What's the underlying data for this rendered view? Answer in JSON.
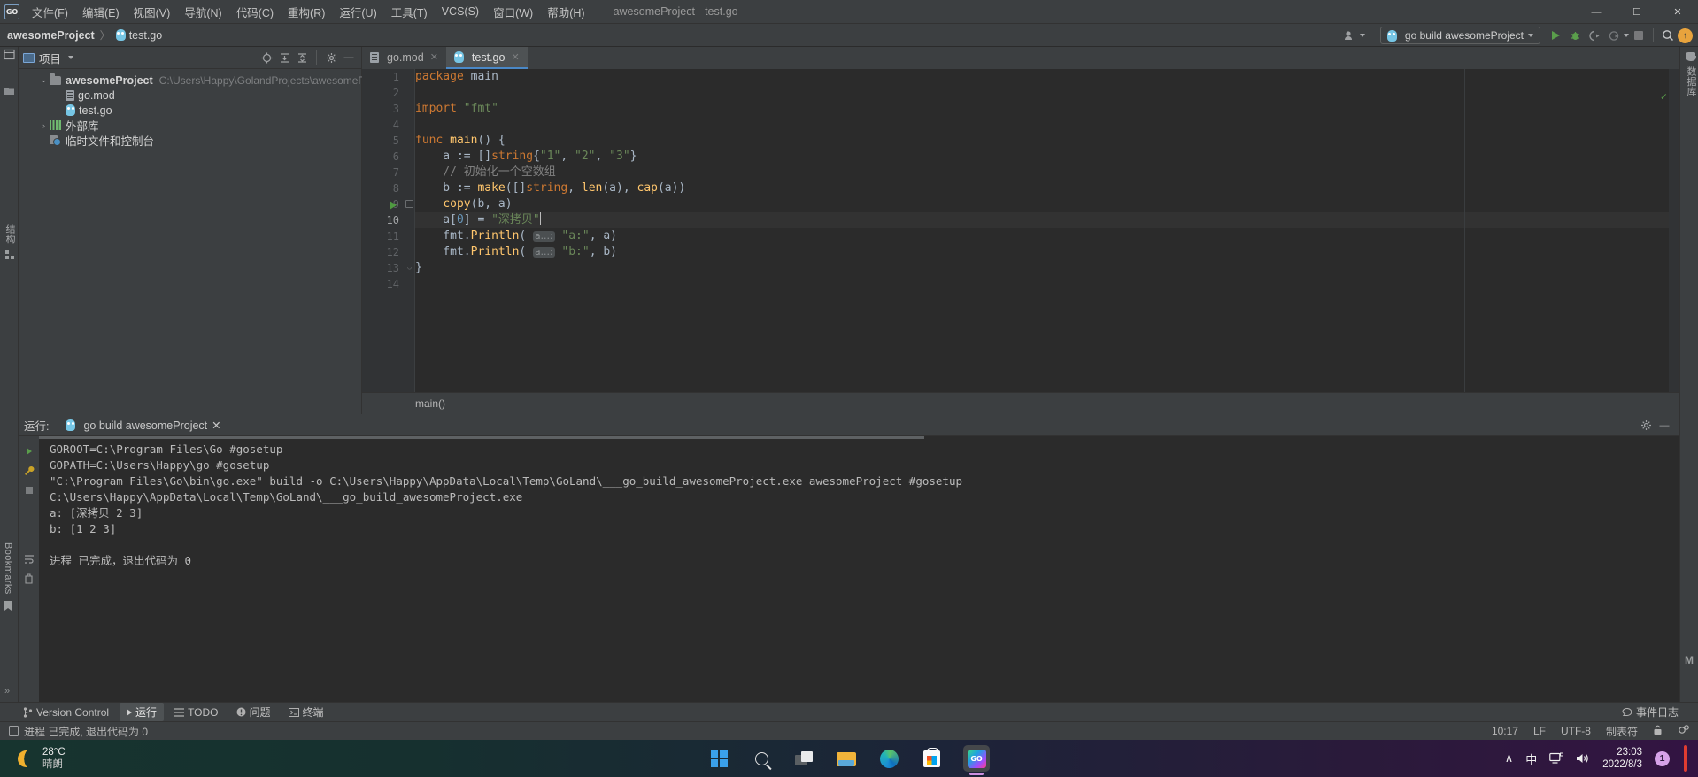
{
  "window": {
    "title": "awesomeProject - test.go",
    "controls": {
      "minimize": "—",
      "maximize": "☐",
      "close": "✕"
    }
  },
  "menu": {
    "items": [
      {
        "label": "文件(F)"
      },
      {
        "label": "编辑(E)"
      },
      {
        "label": "视图(V)"
      },
      {
        "label": "导航(N)"
      },
      {
        "label": "代码(C)"
      },
      {
        "label": "重构(R)"
      },
      {
        "label": "运行(U)"
      },
      {
        "label": "工具(T)"
      },
      {
        "label": "VCS(S)"
      },
      {
        "label": "窗口(W)"
      },
      {
        "label": "帮助(H)"
      }
    ]
  },
  "breadcrumb": {
    "project": "awesomeProject",
    "separator": "〉",
    "file": "test.go"
  },
  "toolbar": {
    "run_config": "go build awesomeProject",
    "icons": [
      "user-avatar-icon",
      "run-icon",
      "debug-icon",
      "run-coverage-icon",
      "profile-icon",
      "stop-icon",
      "search-everywhere-icon",
      "update-icon"
    ],
    "update_glyph": "↑",
    "search_glyph": "⌕",
    "stop_glyph": "■"
  },
  "left_stripe": {
    "items": [
      "结构",
      "Bookmarks"
    ]
  },
  "right_stripe": {
    "items": [
      "数据库"
    ],
    "bottom_label": "M"
  },
  "project_panel": {
    "title": "项目",
    "header_icons": [
      "locate-icon",
      "expand-all-icon",
      "collapse-all-icon",
      "settings-icon",
      "hide-icon"
    ],
    "tree": [
      {
        "depth": 0,
        "arrow": "⌄",
        "icon": "folder-icon",
        "name": "awesomeProject",
        "bold": true,
        "path": "C:\\Users\\Happy\\GolandProjects\\awesomeProject"
      },
      {
        "depth": 1,
        "arrow": "",
        "icon": "gomod-icon",
        "name": "go.mod",
        "bold": false,
        "path": ""
      },
      {
        "depth": 1,
        "arrow": "",
        "icon": "gofile-icon",
        "name": "test.go",
        "bold": false,
        "path": ""
      },
      {
        "depth": 0,
        "arrow": "›",
        "icon": "library-icon",
        "name": "外部库",
        "bold": false,
        "path": ""
      },
      {
        "depth": 0,
        "arrow": "",
        "icon": "scratch-icon",
        "name": "临时文件和控制台",
        "bold": false,
        "path": ""
      }
    ]
  },
  "editor": {
    "tabs": [
      {
        "label": "go.mod",
        "icon": "gomod-icon",
        "active": false,
        "close": "✕"
      },
      {
        "label": "test.go",
        "icon": "gofile-icon",
        "active": true,
        "close": "✕"
      }
    ],
    "gutter_lines": [
      "1",
      "2",
      "3",
      "4",
      "5",
      "6",
      "7",
      "8",
      "9",
      "10",
      "11",
      "12",
      "13",
      "14"
    ],
    "current_line": 10,
    "run_marker_line": 5,
    "lines": [
      {
        "n": 1,
        "tokens": [
          {
            "t": "kw",
            "v": "package"
          },
          {
            "t": "txt",
            "v": " main"
          }
        ]
      },
      {
        "n": 2,
        "tokens": []
      },
      {
        "n": 3,
        "tokens": [
          {
            "t": "kw",
            "v": "import"
          },
          {
            "t": "txt",
            "v": " "
          },
          {
            "t": "str",
            "v": "\"fmt\""
          }
        ]
      },
      {
        "n": 4,
        "tokens": []
      },
      {
        "n": 5,
        "tokens": [
          {
            "t": "kw",
            "v": "func"
          },
          {
            "t": "txt",
            "v": " "
          },
          {
            "t": "fn",
            "v": "main"
          },
          {
            "t": "txt",
            "v": "() {"
          }
        ]
      },
      {
        "n": 6,
        "tokens": [
          {
            "t": "txt",
            "v": "    a := []"
          },
          {
            "t": "kw",
            "v": "string"
          },
          {
            "t": "txt",
            "v": "{"
          },
          {
            "t": "str",
            "v": "\"1\""
          },
          {
            "t": "txt",
            "v": ", "
          },
          {
            "t": "str",
            "v": "\"2\""
          },
          {
            "t": "txt",
            "v": ", "
          },
          {
            "t": "str",
            "v": "\"3\""
          },
          {
            "t": "txt",
            "v": "}"
          }
        ]
      },
      {
        "n": 7,
        "tokens": [
          {
            "t": "cmt",
            "v": "    // 初始化一个空数组"
          }
        ]
      },
      {
        "n": 8,
        "tokens": [
          {
            "t": "txt",
            "v": "    b := "
          },
          {
            "t": "fn",
            "v": "make"
          },
          {
            "t": "txt",
            "v": "([]"
          },
          {
            "t": "kw",
            "v": "string"
          },
          {
            "t": "txt",
            "v": ", "
          },
          {
            "t": "fn",
            "v": "len"
          },
          {
            "t": "txt",
            "v": "(a), "
          },
          {
            "t": "fn",
            "v": "cap"
          },
          {
            "t": "txt",
            "v": "(a))"
          }
        ]
      },
      {
        "n": 9,
        "tokens": [
          {
            "t": "txt",
            "v": "    "
          },
          {
            "t": "fn",
            "v": "copy"
          },
          {
            "t": "txt",
            "v": "(b, a)"
          }
        ]
      },
      {
        "n": 10,
        "tokens": [
          {
            "t": "txt",
            "v": "    a["
          },
          {
            "t": "num",
            "v": "0"
          },
          {
            "t": "txt",
            "v": "] = "
          },
          {
            "t": "str",
            "v": "\"深拷贝\""
          },
          {
            "t": "caret",
            "v": ""
          }
        ]
      },
      {
        "n": 11,
        "tokens": [
          {
            "t": "txt",
            "v": "    fmt."
          },
          {
            "t": "fn",
            "v": "Println"
          },
          {
            "t": "txt",
            "v": "( "
          },
          {
            "t": "hint",
            "v": "a…:"
          },
          {
            "t": "txt",
            "v": " "
          },
          {
            "t": "str",
            "v": "\"a:\""
          },
          {
            "t": "txt",
            "v": ", a)"
          }
        ]
      },
      {
        "n": 12,
        "tokens": [
          {
            "t": "txt",
            "v": "    fmt."
          },
          {
            "t": "fn",
            "v": "Println"
          },
          {
            "t": "txt",
            "v": "( "
          },
          {
            "t": "hint",
            "v": "a…:"
          },
          {
            "t": "txt",
            "v": " "
          },
          {
            "t": "str",
            "v": "\"b:\""
          },
          {
            "t": "txt",
            "v": ", b)"
          }
        ]
      },
      {
        "n": 13,
        "tokens": [
          {
            "t": "txt",
            "v": "}"
          }
        ]
      },
      {
        "n": 14,
        "tokens": []
      }
    ],
    "inspection_status": "✓",
    "breadcrumb": "main()"
  },
  "run_window": {
    "label": "运行:",
    "tab": "go build awesomeProject",
    "tab_close": "✕",
    "console_lines": [
      "GOROOT=C:\\Program Files\\Go #gosetup",
      "GOPATH=C:\\Users\\Happy\\go #gosetup",
      "\"C:\\Program Files\\Go\\bin\\go.exe\" build -o C:\\Users\\Happy\\AppData\\Local\\Temp\\GoLand\\___go_build_awesomeProject.exe awesomeProject #gosetup",
      "C:\\Users\\Happy\\AppData\\Local\\Temp\\GoLand\\___go_build_awesomeProject.exe",
      "a: [深拷贝 2 3]",
      "b: [1 2 3]",
      "",
      "进程 已完成，退出代码为 0"
    ],
    "side_icons": [
      "rerun-icon",
      "settings-wrench-icon",
      "stop-icon",
      "soft-wrap-icon",
      "trash-icon"
    ]
  },
  "toolwindow_bar": {
    "items": [
      {
        "label": "Version Control",
        "icon": "branch-icon",
        "active": false
      },
      {
        "label": "运行",
        "icon": "run-icon",
        "active": true
      },
      {
        "label": "TODO",
        "icon": "todo-icon",
        "active": false
      },
      {
        "label": "问题",
        "icon": "problems-icon",
        "active": false
      },
      {
        "label": "终端",
        "icon": "terminal-icon",
        "active": false
      }
    ],
    "right_item": {
      "label": "事件日志",
      "icon": "event-log-icon"
    }
  },
  "status_bar": {
    "message": "进程 已完成, 退出代码为 0",
    "cursor_position": "10:17",
    "line_separator": "LF",
    "encoding": "UTF-8",
    "indent": "制表符",
    "lock_icon": "⚿",
    "inspector_icon": "gear-icon"
  },
  "taskbar": {
    "weather": {
      "temperature": "28°C",
      "condition": "晴朗",
      "icon": "moon-icon"
    },
    "apps": [
      {
        "name": "start-button"
      },
      {
        "name": "search-button"
      },
      {
        "name": "task-view-button"
      },
      {
        "name": "file-explorer-button"
      },
      {
        "name": "edge-browser-button"
      },
      {
        "name": "microsoft-store-button"
      },
      {
        "name": "goland-button",
        "label": "GO",
        "active": true
      }
    ],
    "tray": {
      "chevron": "∧",
      "ime": "中",
      "network_icon": "network-icon",
      "volume_icon": "🔊",
      "time": "23:03",
      "date": "2022/8/3",
      "notification_count": "1"
    }
  }
}
